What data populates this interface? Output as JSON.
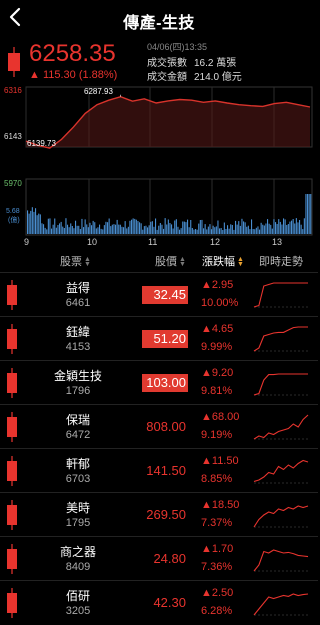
{
  "header": {
    "title": "傳產-生技"
  },
  "quote": {
    "price": "6258.35",
    "change": "▲ 115.30 (1.88%)",
    "time": "04/06(四)13:35",
    "volume_label": "成交張數",
    "volume_value": "16.2 萬張",
    "amount_label": "成交金額",
    "amount_value": "214.0 億元"
  },
  "chart_labels": {
    "y_max": "6316",
    "y_min": "6143",
    "peak": "6287.93",
    "trough": "6139.73",
    "vol_max": "5970",
    "vol_unit_value": "5.68",
    "vol_unit": "(億)",
    "x_ticks": [
      "9",
      "10",
      "11",
      "12",
      "13"
    ]
  },
  "chart_data": {
    "type": "line",
    "x_ticks": [
      "9",
      "10",
      "11",
      "12",
      "13"
    ],
    "series": [
      {
        "values": [
          6160,
          6148,
          6139.73,
          6165,
          6200,
          6240,
          6265,
          6278,
          6287.93,
          6275,
          6282,
          6270,
          6276,
          6280,
          6278,
          6272,
          6276,
          6270,
          6265,
          6262,
          6260,
          6268,
          6272,
          6265,
          6258.35
        ]
      }
    ],
    "ylim": [
      6143,
      6316
    ],
    "grid": true,
    "colors": {
      "line": "#d8332b",
      "fill": "#5a1a18",
      "volume": "#4a8ed0"
    }
  },
  "table": {
    "headers": [
      "股票",
      "股價",
      "漲跌幅",
      "即時走勢"
    ],
    "rows": [
      {
        "name": "益得",
        "code": "6461",
        "price": "32.45",
        "change": "▲2.95",
        "percent": "10.00%",
        "limit": true,
        "spark": [
          0.1,
          0.15,
          0.8,
          0.85,
          0.9,
          0.9,
          0.9,
          0.9,
          0.9,
          0.9,
          0.9,
          0.9
        ]
      },
      {
        "name": "鈺緯",
        "code": "4153",
        "price": "51.20",
        "change": "▲4.65",
        "percent": "9.99%",
        "limit": true,
        "spark": [
          0.1,
          0.2,
          0.6,
          0.65,
          0.7,
          0.72,
          0.72,
          0.8,
          0.88,
          0.9,
          0.9,
          0.9
        ]
      },
      {
        "name": "金穎生技",
        "code": "1796",
        "price": "103.00",
        "change": "▲9.20",
        "percent": "9.81%",
        "limit": true,
        "spark": [
          0.1,
          0.15,
          0.6,
          0.78,
          0.78,
          0.8,
          0.8,
          0.8,
          0.8,
          0.8,
          0.8,
          0.8
        ]
      },
      {
        "name": "保瑞",
        "code": "6472",
        "price": "808.00",
        "change": "▲68.00",
        "percent": "9.19%",
        "limit": false,
        "spark": [
          0.1,
          0.2,
          0.15,
          0.3,
          0.25,
          0.35,
          0.4,
          0.45,
          0.6,
          0.5,
          0.75,
          0.9
        ]
      },
      {
        "name": "軒郁",
        "code": "6703",
        "price": "141.50",
        "change": "▲11.50",
        "percent": "8.85%",
        "limit": false,
        "spark": [
          0.15,
          0.2,
          0.3,
          0.45,
          0.4,
          0.65,
          0.55,
          0.7,
          0.6,
          0.75,
          0.85,
          0.8
        ]
      },
      {
        "name": "美時",
        "code": "1795",
        "price": "269.50",
        "change": "▲18.50",
        "percent": "7.37%",
        "limit": false,
        "spark": [
          0.1,
          0.35,
          0.5,
          0.6,
          0.55,
          0.7,
          0.65,
          0.75,
          0.7,
          0.8,
          0.75,
          0.8
        ]
      },
      {
        "name": "商之器",
        "code": "8409",
        "price": "24.80",
        "change": "▲1.70",
        "percent": "7.36%",
        "limit": false,
        "spark": [
          0.1,
          0.3,
          0.75,
          0.7,
          0.8,
          0.75,
          0.7,
          0.72,
          0.68,
          0.62,
          0.6,
          0.58
        ]
      },
      {
        "name": "佰研",
        "code": "3205",
        "price": "42.30",
        "change": "▲2.50",
        "percent": "6.28%",
        "limit": false,
        "spark": [
          0.1,
          0.3,
          0.5,
          0.7,
          0.65,
          0.7,
          0.75,
          0.72,
          0.8,
          0.75,
          0.78,
          0.8
        ]
      }
    ]
  },
  "colors": {
    "up": "#e8342e",
    "limit_bg": "#e13a30",
    "accent": "#e8a030",
    "volume": "#4a8ed0"
  },
  "icons": {
    "back": "chevron-left-icon",
    "candle": "candlestick-icon"
  }
}
